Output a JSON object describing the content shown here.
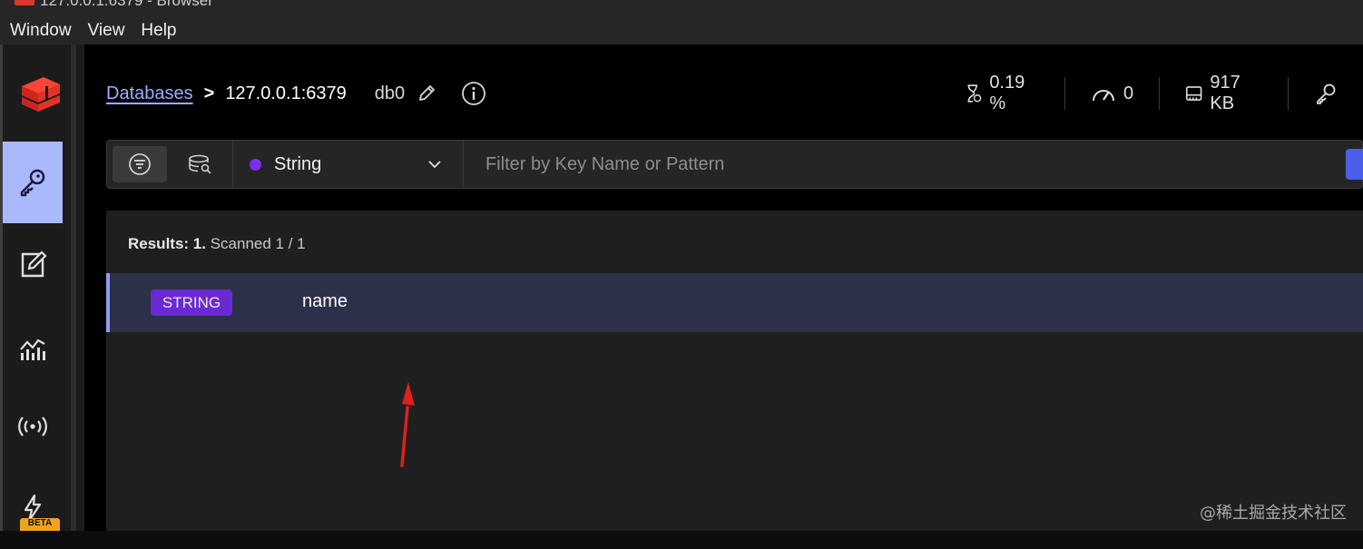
{
  "window": {
    "title": "127.0.0.1:6379 - Browser"
  },
  "menu": {
    "items": [
      "Window",
      "View",
      "Help"
    ]
  },
  "sidebar": {
    "active": "browser",
    "beta_label": "BETA"
  },
  "breadcrumb": {
    "databases_link": "Databases",
    "separator": ">",
    "host": "127.0.0.1:6379",
    "db": "db0"
  },
  "stats": {
    "cpu": "0.19 %",
    "ops": "0",
    "memory": "917 KB"
  },
  "filter": {
    "key_type": "String",
    "key_type_color": "#7b2ff0",
    "search_placeholder": "Filter by Key Name or Pattern"
  },
  "results": {
    "summary_bold": "Results: 1.",
    "summary_rest": "Scanned 1 / 1",
    "rows": [
      {
        "type": "STRING",
        "name": "name"
      }
    ]
  },
  "watermark": "@稀土掘金技术社区",
  "colors": {
    "accent": "#a9b9fb",
    "badge": "#6a2ad1",
    "annotation_arrow": "#e0201a"
  }
}
